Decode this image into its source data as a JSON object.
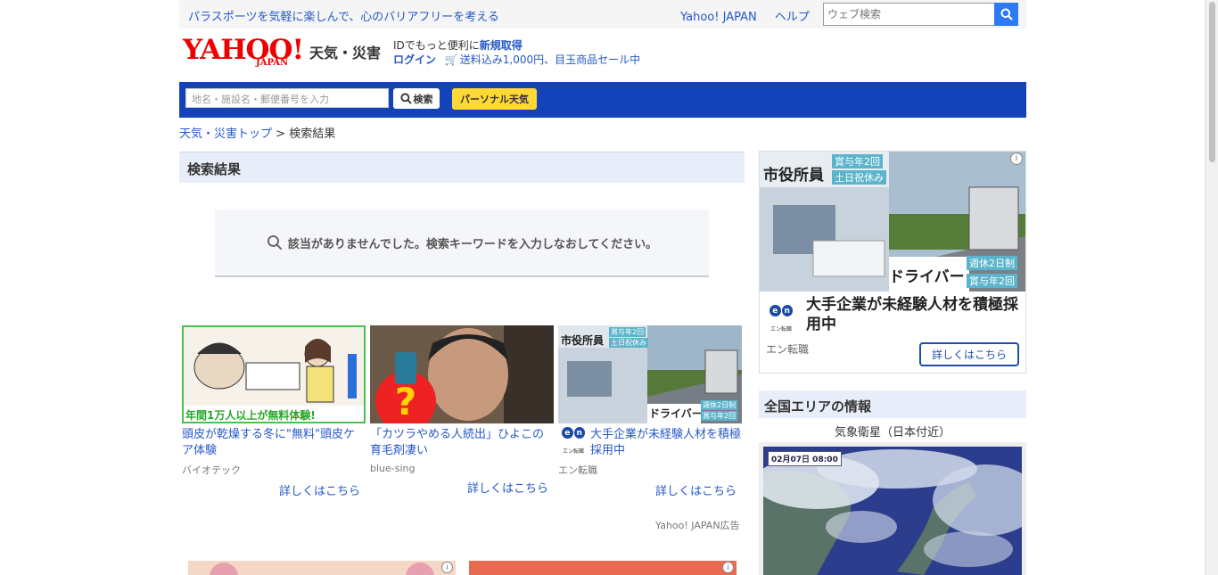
{
  "topbar": {
    "slogan": "パラスポーツを気軽に楽しんで、心のバリアフリーを考える",
    "link_yahoo": "Yahoo! JAPAN",
    "link_help": "ヘルプ",
    "search_placeholder": "ウェブ検索"
  },
  "header": {
    "logo_text": "YAHOO!",
    "logo_sub": "JAPAN",
    "service_name": "天気・災害",
    "id_text": "IDでもっと便利に",
    "signup": "新規取得",
    "login": "ログイン",
    "promo": "送料込み1,000円、目玉商品セール中"
  },
  "nav": {
    "location_placeholder": "地名・施設名・郵便番号を入力",
    "search_button": "検索",
    "personal_button": "パーソナル天気"
  },
  "breadcrumb": {
    "top": "天気・災害トップ",
    "separator": ">",
    "current": "検索結果"
  },
  "results": {
    "heading": "検索結果",
    "empty_message": "該当がありませんでした。検索キーワードを入力しなおしてください。"
  },
  "ads": [
    {
      "title": "頭皮が乾燥する冬に\"無料\"頭皮ケア体験",
      "source": "バイオテック",
      "more": "詳しくはこちら",
      "caption": "年間1万人以上が無料体験!"
    },
    {
      "title": "「カツラやめる人続出」ひよこの育毛剤凄い",
      "source": "blue-sing",
      "more": "詳しくはこちら"
    },
    {
      "title": "大手企業が未経験人材を積極採用中",
      "source": "エン転職",
      "more": "詳しくはこちら",
      "tag1": "市役所員",
      "tag2": "ドライバー",
      "badge1": "賞与年2回",
      "badge2": "土日祝休み",
      "badge3": "週休2日制",
      "badge4": "賞与年2回"
    }
  ],
  "ad_label": "Yahoo! JAPAN広告",
  "side_ad": {
    "title": "大手企業が未経験人材を積極採用中",
    "source": "エン転職",
    "cta": "詳しくはこちら",
    "tag1": "市役所員",
    "tag2": "ドライバー",
    "badge1": "賞与年2回",
    "badge2": "土日祝休み",
    "badge3": "週休2日制",
    "badge4": "賞与年2回",
    "info": "i",
    "logo_sub": "エン転職"
  },
  "area": {
    "heading": "全国エリアの情報",
    "satellite_caption": "気象衛星（日本付近）",
    "timestamp": "02月07日 08:00"
  },
  "colors": {
    "brand_blue": "#1342b9",
    "link_blue": "#2558c8",
    "yahoo_red": "#e00",
    "yellow": "#ffd836"
  }
}
